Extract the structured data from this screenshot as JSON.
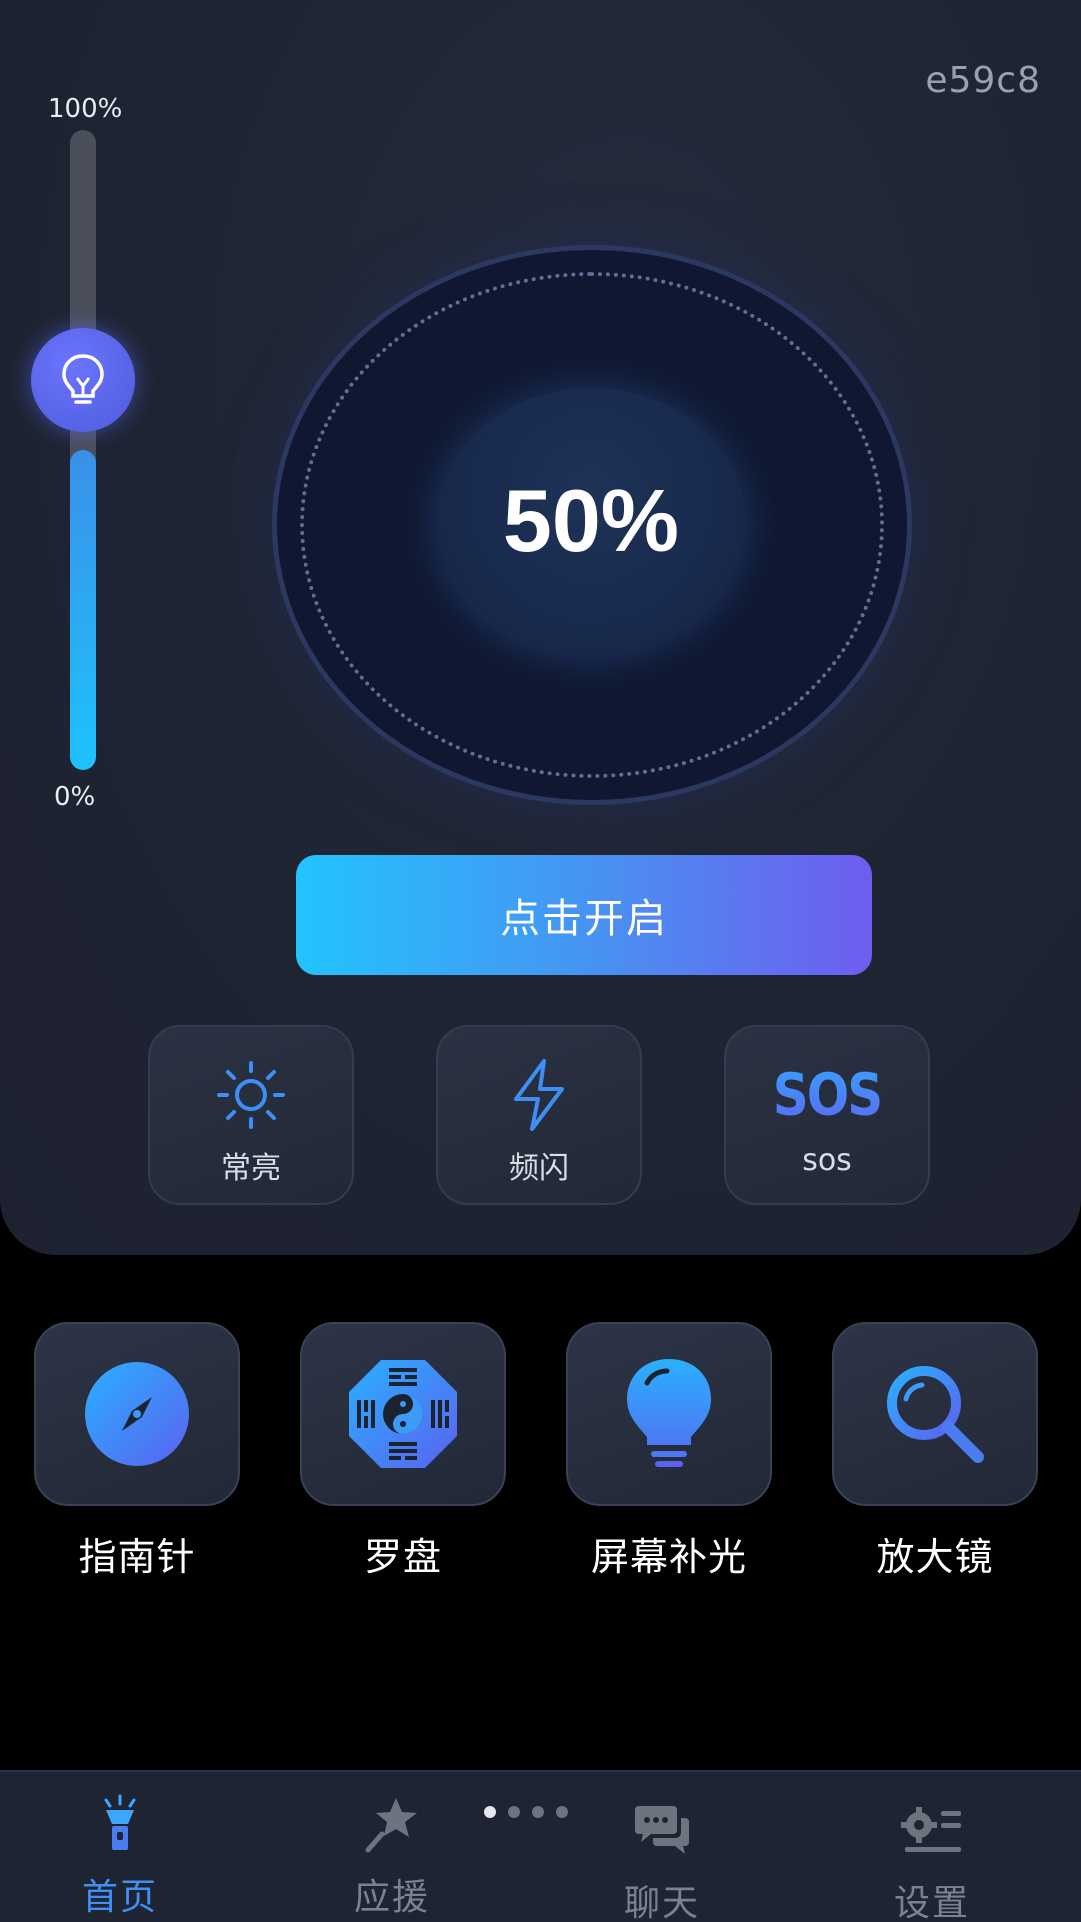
{
  "device_id": "e59c8",
  "brightness": {
    "max_label": "100%",
    "min_label": "0%",
    "level": 0.5,
    "value_text": "50%"
  },
  "start_button": {
    "label": "点击开启"
  },
  "modes": [
    {
      "label": "常亮",
      "icon": "sun-icon"
    },
    {
      "label": "频闪",
      "icon": "lightning-icon"
    },
    {
      "label": "sos",
      "icon": "sos-icon",
      "glyph": "SOS"
    }
  ],
  "tools": [
    {
      "label": "指南针",
      "icon": "compass-icon"
    },
    {
      "label": "罗盘",
      "icon": "bagua-icon"
    },
    {
      "label": "屏幕补光",
      "icon": "lightbulb-icon"
    },
    {
      "label": "放大镜",
      "icon": "magnifier-icon"
    }
  ],
  "nav": [
    {
      "label": "首页",
      "icon": "flashlight-icon",
      "active": true
    },
    {
      "label": "应援",
      "icon": "star-wand-icon",
      "active": false
    },
    {
      "label": "聊天",
      "icon": "chat-icon",
      "active": false
    },
    {
      "label": "设置",
      "icon": "settings-icon",
      "active": false
    }
  ],
  "page_indicator": {
    "count": 4,
    "current": 1
  },
  "colors": {
    "panel": "#1f2433",
    "accent_blue": "#1ec2ff",
    "accent_purple": "#6f5df0",
    "active_nav": "#3f8ff5"
  }
}
